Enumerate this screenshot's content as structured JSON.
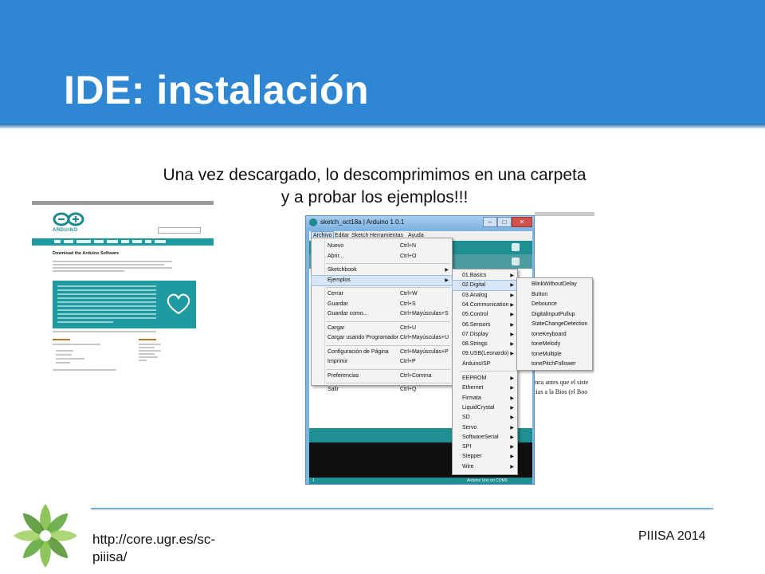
{
  "slide": {
    "title": "IDE: instalación",
    "subtitle_line1": "Una vez descargado, lo descomprimimos en una carpeta",
    "subtitle_line2": "y a probar los ejemplos!!!",
    "footer_url": "http://core.ugr.es/sc-piiisa/",
    "footer_right": "PIIISA 2014"
  },
  "website": {
    "logo_text": "ARDUINO",
    "heading": "Download the Arduino Software"
  },
  "ide": {
    "window_title": "sketch_oct18a | Arduino 1.0.1",
    "menubar": [
      "Archivo",
      "Editar",
      "Sketch",
      "Herramientas",
      "Ayuda"
    ],
    "status_left": "1",
    "status_right": "Arduino Uno on COM3",
    "doc_text_line1": "inca antes que el siste",
    "doc_text_line2": "cias a la Bios (el Boo",
    "archivo_menu": [
      {
        "label": "Nuevo",
        "shortcut": "Ctrl+N"
      },
      {
        "label": "Abrir...",
        "shortcut": "Ctrl+O"
      },
      {
        "label": "Sketchbook",
        "shortcut": "",
        "submenu": true
      },
      {
        "label": "Ejemplos",
        "shortcut": "",
        "submenu": true
      },
      {
        "label": "Cerrar",
        "shortcut": "Ctrl+W"
      },
      {
        "label": "Guardar",
        "shortcut": "Ctrl+S"
      },
      {
        "label": "Guardar como...",
        "shortcut": "Ctrl+Mayúsculas+S"
      },
      {
        "label": "Cargar",
        "shortcut": "Ctrl+U"
      },
      {
        "label": "Cargar usando Programador",
        "shortcut": "Ctrl+Mayúsculas+U"
      },
      {
        "label": "Configuración de Página",
        "shortcut": "Ctrl+Mayúsculas+P"
      },
      {
        "label": "Imprimir",
        "shortcut": "Ctrl+P"
      },
      {
        "label": "Preferencias",
        "shortcut": "Ctrl+Comma"
      },
      {
        "label": "Salir",
        "shortcut": "Ctrl+Q"
      }
    ],
    "ejemplos_menu": [
      "01.Basics",
      "02.Digital",
      "03.Analog",
      "04.Communication",
      "05.Control",
      "06.Sensors",
      "07.Display",
      "08.Strings",
      "09.USB(Leonardo)",
      "ArduinoISP",
      "EEPROM",
      "Ethernet",
      "Firmata",
      "LiquidCrystal",
      "SD",
      "Servo",
      "SoftwareSerial",
      "SPI",
      "Stepper",
      "Wire"
    ],
    "digital_menu": [
      "BlinkWithoutDelay",
      "Button",
      "Debounce",
      "DigitalInputPullup",
      "StateChangeDetection",
      "toneKeyboard",
      "toneMelody",
      "toneMultiple",
      "tonePitchFollower"
    ]
  },
  "colors": {
    "header": "#2f87d4",
    "arduino_teal": "#1e8f93",
    "logo_green": "#7dbb42"
  }
}
